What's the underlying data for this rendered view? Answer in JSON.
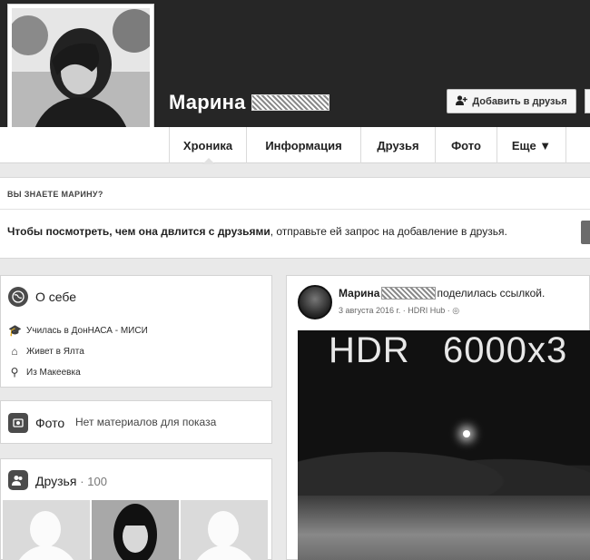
{
  "profile": {
    "name": "Марина"
  },
  "header": {
    "add_friend_label": "Добавить в друзья",
    "add_friend_icon": "add-user-icon"
  },
  "nav": {
    "tabs": [
      {
        "label": "Хроника"
      },
      {
        "label": "Информация"
      },
      {
        "label": "Друзья"
      },
      {
        "label": "Фото"
      },
      {
        "label": "Еще ▼"
      }
    ]
  },
  "banner": {
    "title": "ВЫ ЗНАЕТЕ МАРИНУ?",
    "text_bold": "Чтобы посмотреть, чем она двлится с друзьями",
    "text_rest": ", отправьте ей запрос на добавление в друзья."
  },
  "about": {
    "title": "О себе",
    "items": [
      {
        "icon": "education-icon",
        "text": "Училась в ДонНАСА - МИСИ"
      },
      {
        "icon": "home-icon",
        "text": "Живет в Ялта"
      },
      {
        "icon": "location-pin-icon",
        "text": "Из Макеевка"
      }
    ]
  },
  "photos": {
    "title": "Фото",
    "empty_text": "Нет материалов для показа"
  },
  "friends": {
    "title": "Друзья",
    "count": "· 100"
  },
  "post": {
    "author": "Марина",
    "action": "поделилась ссылкой.",
    "meta": "3 августа 2016 г. · HDRI Hub · ◎",
    "image_text": "HDR   6000x3"
  },
  "colors": {
    "cover": "#262626",
    "page_bg": "#e9e9e9",
    "card_bg": "#ffffff"
  }
}
